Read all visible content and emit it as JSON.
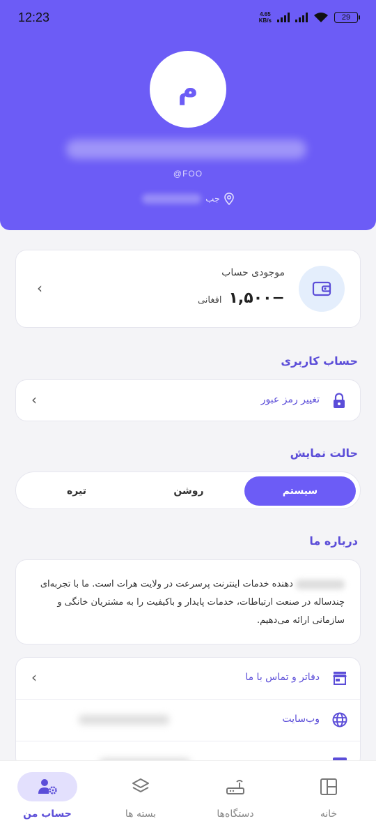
{
  "status_bar": {
    "time": "12:23",
    "net_speed_value": "4.65",
    "net_speed_unit": "KB/s",
    "battery": "29"
  },
  "profile": {
    "avatar_letter": "م",
    "username": "@FOO",
    "location": "جب"
  },
  "balance": {
    "label": "موجودی حساب",
    "amount": "۱,۵۰۰−",
    "currency": "افغانی"
  },
  "account_section": {
    "title": "حساب کاربری",
    "change_password": "تغییر رمز عبور"
  },
  "display_mode": {
    "title": "حالت نمایش",
    "options": [
      "سیستم",
      "روشن",
      "تیره"
    ],
    "selected": "سیستم"
  },
  "about": {
    "title": "درباره ما",
    "text": "دهنده خدمات اینترنت پرسرعت در ولایت هرات است. ما با تجربه‌ای چندساله در صنعت ارتباطات، خدمات پایدار و باکیفیت را به مشتریان خانگی و سازمانی ارائه می‌دهیم."
  },
  "links": {
    "offices": "دفاتر و تماس با ما",
    "website": "وب‌سایت"
  },
  "bottom_nav": {
    "items": [
      "خانه",
      "دستگاه‌ها",
      "بسته ها",
      "حساب من"
    ],
    "active": "حساب من"
  },
  "colors": {
    "primary": "#6c5cf6",
    "primary_text": "#5b4dd8",
    "background": "#f4f4f7"
  }
}
